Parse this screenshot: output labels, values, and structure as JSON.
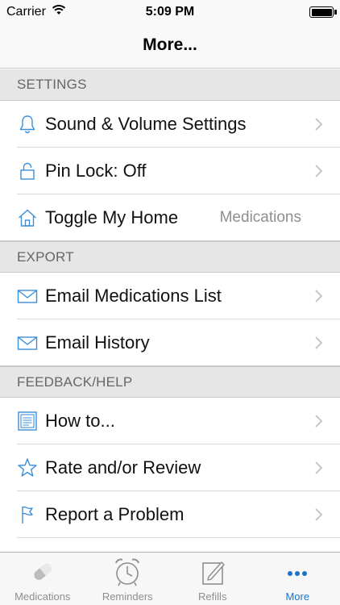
{
  "status_bar": {
    "carrier": "Carrier",
    "time": "5:09 PM"
  },
  "nav": {
    "title": "More..."
  },
  "sections": {
    "settings": {
      "header": "SETTINGS",
      "sound": {
        "label": "Sound & Volume Settings",
        "icon": "bell-icon"
      },
      "pin": {
        "label": "Pin Lock: Off",
        "icon": "lock-icon"
      },
      "home": {
        "label": "Toggle My Home",
        "detail": "Medications",
        "icon": "house-icon"
      }
    },
    "export": {
      "header": "EXPORT",
      "email_meds": {
        "label": "Email Medications List",
        "icon": "envelope-icon"
      },
      "email_history": {
        "label": "Email History",
        "icon": "envelope-icon"
      }
    },
    "feedback": {
      "header": "FEEDBACK/HELP",
      "howto": {
        "label": "How to...",
        "icon": "document-icon"
      },
      "rate": {
        "label": "Rate and/or Review",
        "icon": "star-icon"
      },
      "report": {
        "label": "Report a Problem",
        "icon": "flag-icon"
      }
    }
  },
  "tabs": {
    "medications": {
      "label": "Medications",
      "icon": "pill-icon"
    },
    "reminders": {
      "label": "Reminders",
      "icon": "alarm-clock-icon"
    },
    "refills": {
      "label": "Refills",
      "icon": "pencil-note-icon"
    },
    "more": {
      "label": "More",
      "icon": "ellipsis-icon",
      "selected": true
    }
  },
  "colors": {
    "accent": "#1a73c8",
    "icon_blue": "#3b8fd9",
    "header_bg": "#e6e6e6",
    "header_text": "#666666"
  }
}
